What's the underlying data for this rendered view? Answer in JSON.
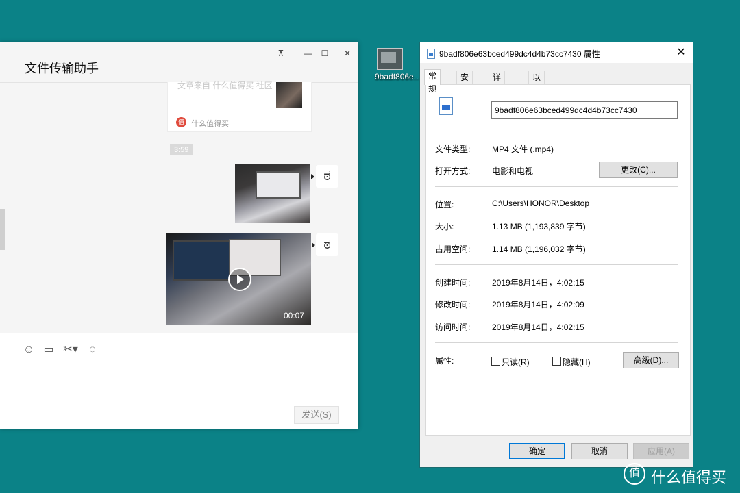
{
  "wechat": {
    "title": "文件传输助手",
    "controls": [
      "⊼",
      "☐",
      "✕"
    ],
    "card": {
      "faded_text": "文章来自 什么值得买 社区",
      "source": "什么值得买"
    },
    "time": "3:59",
    "video_duration": "00:07",
    "send_label": "发送(S)"
  },
  "desktop_icon": {
    "label": "9badf806e..."
  },
  "props": {
    "title": "9badf806e63bced499dc4d4b73cc7430 属性",
    "tabs": [
      "常规",
      "安全",
      "详细信息",
      "以前的版本"
    ],
    "filename": "9badf806e63bced499dc4d4b73cc7430",
    "rows": {
      "type_label": "文件类型:",
      "type_value": "MP4 文件 (.mp4)",
      "open_label": "打开方式:",
      "open_value": "电影和电视",
      "change_btn": "更改(C)...",
      "loc_label": "位置:",
      "loc_value": "C:\\Users\\HONOR\\Desktop",
      "size_label": "大小:",
      "size_value": "1.13 MB (1,193,839 字节)",
      "disk_label": "占用空间:",
      "disk_value": "1.14 MB (1,196,032 字节)",
      "created_label": "创建时间:",
      "created_value": "2019年8月14日，4:02:15",
      "modified_label": "修改时间:",
      "modified_value": "2019年8月14日，4:02:09",
      "accessed_label": "访问时间:",
      "accessed_value": "2019年8月14日，4:02:15",
      "attr_label": "属性:",
      "readonly": "只读(R)",
      "hidden": "隐藏(H)",
      "advanced_btn": "高级(D)..."
    },
    "ok": "确定",
    "cancel": "取消",
    "apply": "应用(A)"
  },
  "watermark": {
    "logo": "值",
    "text": "什么值得买"
  },
  "colors": {
    "desktop": "#0b8287",
    "primary_border": "#0078d7"
  }
}
